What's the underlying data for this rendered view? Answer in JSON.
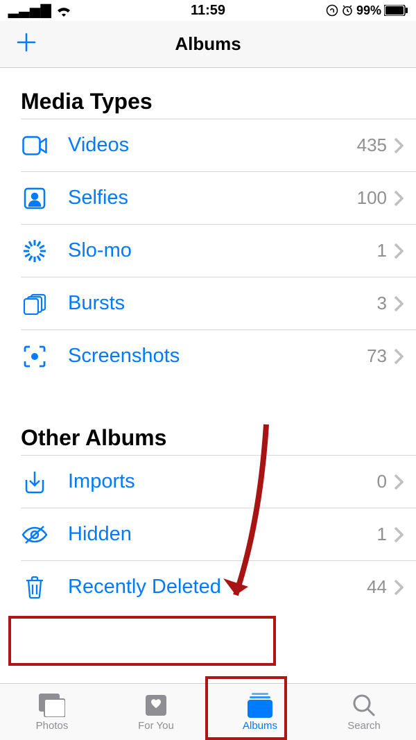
{
  "status": {
    "time": "11:59",
    "battery": "99%"
  },
  "nav": {
    "title": "Albums",
    "add": "+"
  },
  "sections": {
    "media": {
      "title": "Media Types",
      "items": [
        {
          "label": "Videos",
          "count": "435"
        },
        {
          "label": "Selfies",
          "count": "100"
        },
        {
          "label": "Slo-mo",
          "count": "1"
        },
        {
          "label": "Bursts",
          "count": "3"
        },
        {
          "label": "Screenshots",
          "count": "73"
        }
      ]
    },
    "other": {
      "title": "Other Albums",
      "items": [
        {
          "label": "Imports",
          "count": "0"
        },
        {
          "label": "Hidden",
          "count": "1"
        },
        {
          "label": "Recently Deleted",
          "count": "44"
        }
      ]
    }
  },
  "tabs": {
    "photos": "Photos",
    "foryou": "For You",
    "albums": "Albums",
    "search": "Search"
  }
}
